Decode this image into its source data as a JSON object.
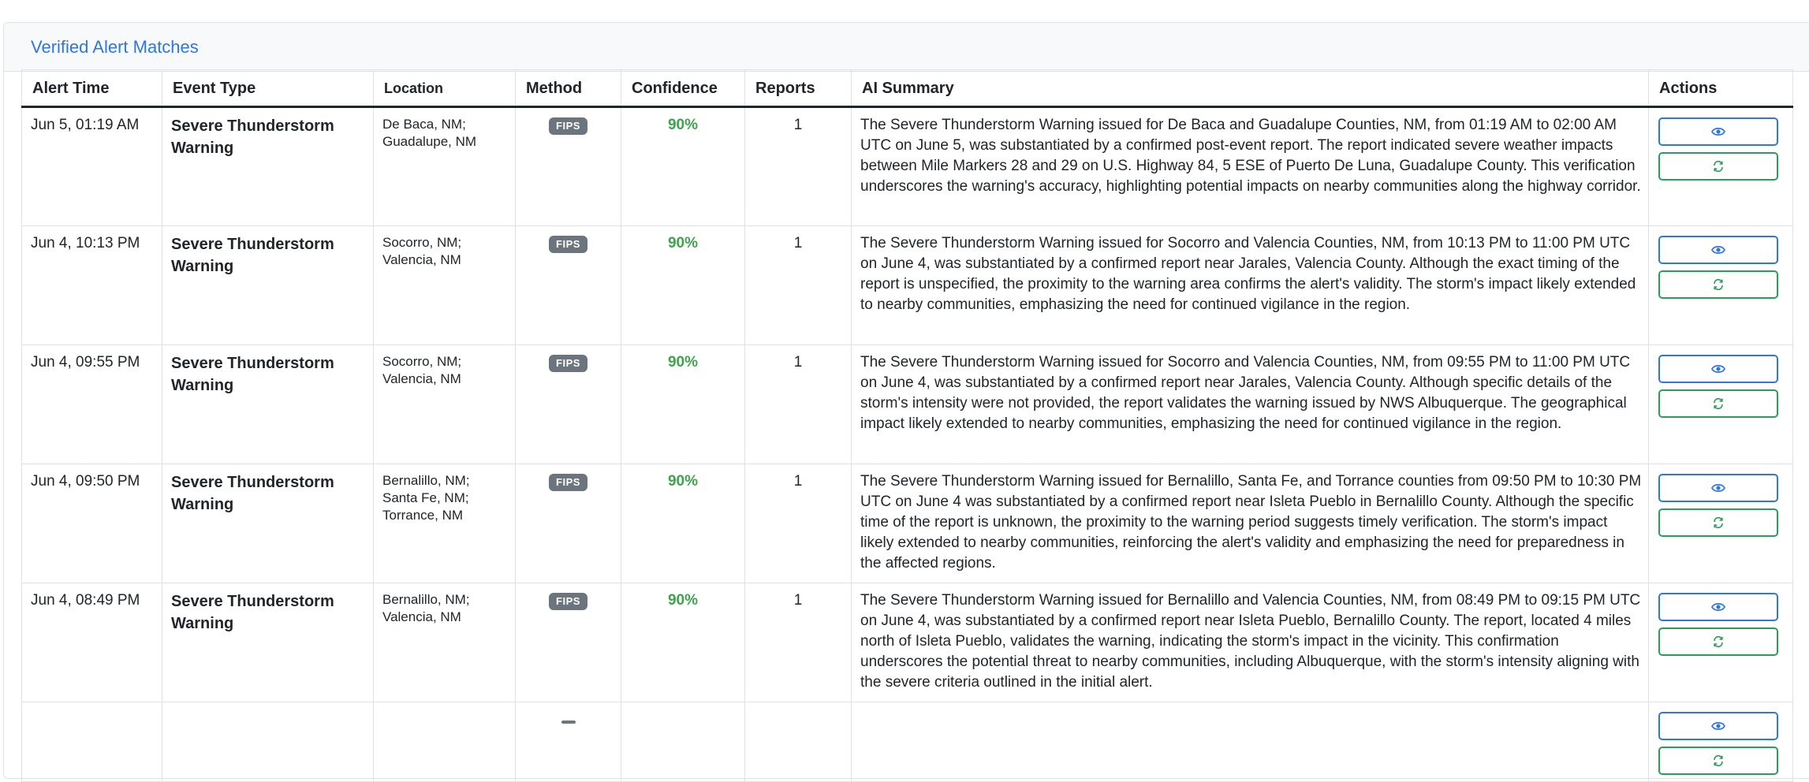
{
  "card": {
    "title": "Verified Alert Matches"
  },
  "table": {
    "headers": {
      "alert_time": "Alert Time",
      "event_type": "Event Type",
      "location": "Location",
      "method": "Method",
      "confidence": "Confidence",
      "reports": "Reports",
      "summary": "AI Summary",
      "actions": "Actions"
    },
    "rows": [
      {
        "time": "Jun 5, 01:19 AM",
        "event": "Severe Thunderstorm Warning",
        "location": [
          "De Baca, NM;",
          "Guadalupe, NM"
        ],
        "method": "FIPS",
        "confidence": "90%",
        "reports": "1",
        "summary": "The Severe Thunderstorm Warning issued for De Baca and Guadalupe Counties, NM, from 01:19 AM to 02:00 AM UTC on June 5, was substantiated by a confirmed post-event report. The report indicated severe weather impacts between Mile Markers 28 and 29 on U.S. Highway 84, 5 ESE of Puerto De Luna, Guadalupe County. This verification underscores the warning's accuracy, highlighting potential impacts on nearby communities along the highway corridor."
      },
      {
        "time": "Jun 4, 10:13 PM",
        "event": "Severe Thunderstorm Warning",
        "location": [
          "Socorro, NM;",
          "Valencia, NM"
        ],
        "method": "FIPS",
        "confidence": "90%",
        "reports": "1",
        "summary": "The Severe Thunderstorm Warning issued for Socorro and Valencia Counties, NM, from 10:13 PM to 11:00 PM UTC on June 4, was substantiated by a confirmed report near Jarales, Valencia County. Although the exact timing of the report is unspecified, the proximity to the warning area confirms the alert's validity. The storm's impact likely extended to nearby communities, emphasizing the need for continued vigilance in the region."
      },
      {
        "time": "Jun 4, 09:55 PM",
        "event": "Severe Thunderstorm Warning",
        "location": [
          "Socorro, NM;",
          "Valencia, NM"
        ],
        "method": "FIPS",
        "confidence": "90%",
        "reports": "1",
        "summary": "The Severe Thunderstorm Warning issued for Socorro and Valencia Counties, NM, from 09:55 PM to 11:00 PM UTC on June 4, was substantiated by a confirmed report near Jarales, Valencia County. Although specific details of the storm's intensity were not provided, the report validates the warning issued by NWS Albuquerque. The geographical impact likely extended to nearby communities, emphasizing the need for continued vigilance in the region."
      },
      {
        "time": "Jun 4, 09:50 PM",
        "event": "Severe Thunderstorm Warning",
        "location": [
          "Bernalillo, NM;",
          "Santa Fe, NM;",
          "Torrance, NM"
        ],
        "method": "FIPS",
        "confidence": "90%",
        "reports": "1",
        "summary": "The Severe Thunderstorm Warning issued for Bernalillo, Santa Fe, and Torrance counties from 09:50 PM to 10:30 PM UTC on June 4 was substantiated by a confirmed report near Isleta Pueblo in Bernalillo County. Although the specific time of the report is unknown, the proximity to the warning period suggests timely verification. The storm's impact likely extended to nearby communities, reinforcing the alert's validity and emphasizing the need for preparedness in the affected regions."
      },
      {
        "time": "Jun 4, 08:49 PM",
        "event": "Severe Thunderstorm Warning",
        "location": [
          "Bernalillo, NM;",
          "Valencia, NM"
        ],
        "method": "FIPS",
        "confidence": "90%",
        "reports": "1",
        "summary": "The Severe Thunderstorm Warning issued for Bernalillo and Valencia Counties, NM, from 08:49 PM to 09:15 PM UTC on June 4, was substantiated by a confirmed report near Isleta Pueblo, Bernalillo County. The report, located 4 miles north of Isleta Pueblo, validates the warning, indicating the storm's impact in the vicinity. This confirmation underscores the potential threat to nearby communities, including Albuquerque, with the storm's intensity aligning with the severe criteria outlined in the initial alert."
      }
    ]
  },
  "icons": {
    "view": "eye-icon",
    "refresh": "refresh-icon"
  },
  "colors": {
    "accent": "#2f76e1",
    "success": "#2a9d58",
    "confidence": "#3fa34d",
    "badge": "#6c757d"
  }
}
